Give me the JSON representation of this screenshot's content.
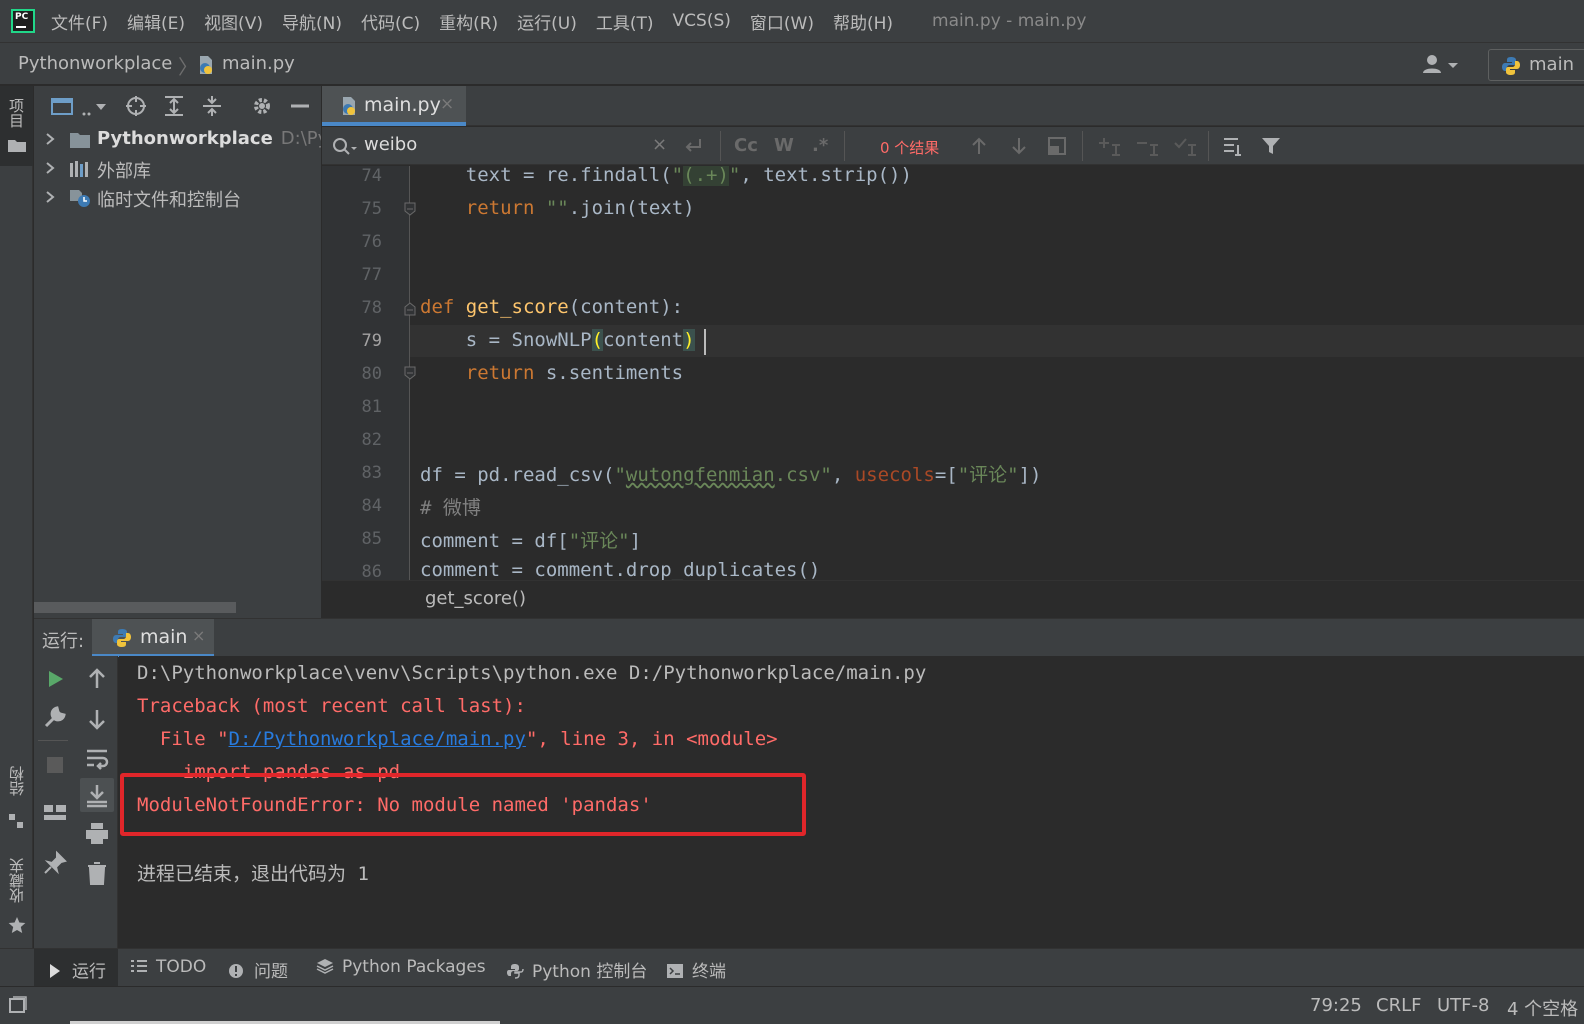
{
  "menubar": {
    "logo_text": "PC",
    "items": [
      "文件(F)",
      "编辑(E)",
      "视图(V)",
      "导航(N)",
      "代码(C)",
      "重构(R)",
      "运行(U)",
      "工具(T)",
      "VCS(S)",
      "窗口(W)",
      "帮助(H)"
    ],
    "window_title": "main.py - main.py"
  },
  "navbar": {
    "project": "Pythonworkplace",
    "separator": "〉",
    "file": "main.py",
    "run_config": "main"
  },
  "left_strip": {
    "project_label": "项目",
    "structure_label": "结构",
    "favorites_label": "收藏夹"
  },
  "project_tree": [
    {
      "label": "Pythonworkplace",
      "path": "D:\\Pyth",
      "icon": "folder-icon"
    },
    {
      "label": "外部库",
      "path": "",
      "icon": "library-icon"
    },
    {
      "label": "临时文件和控制台",
      "path": "",
      "icon": "scratch-icon"
    }
  ],
  "editor": {
    "tab_label": "main.py",
    "tab_close": "×",
    "find": {
      "query": "weibo",
      "clear": "×",
      "match_case": "Cc",
      "words": "W",
      "regex": ".*",
      "result": "0 个结果"
    },
    "line_numbers": [
      "74",
      "75",
      "76",
      "77",
      "78",
      "79",
      "80",
      "81",
      "82",
      "83",
      "84",
      "85",
      "86"
    ],
    "current_line": "79",
    "breadcrumb": "get_score()"
  },
  "run_panel": {
    "title": "运行:",
    "tab_label": "main",
    "tab_close": "×",
    "console": {
      "cmd": "D:\\Pythonworkplace\\venv\\Scripts\\python.exe D:/Pythonworkplace/main.py",
      "traceback": "Traceback (most recent call last):",
      "file_prefix": "  File \"",
      "file_link": "D:/Pythonworkplace/main.py",
      "file_suffix": "\", line 3, in <module>",
      "import_line": "    import pandas as pd",
      "error": "ModuleNotFoundError: No module named 'pandas'",
      "exit": "进程已结束，退出代码为 1"
    }
  },
  "toolwindows": {
    "run": "运行",
    "todo": "TODO",
    "problems": "问题",
    "packages": "Python Packages",
    "console": "Python 控制台",
    "terminal": "终端"
  },
  "status": {
    "position": "79:25",
    "line_sep": "CRLF",
    "encoding": "UTF-8",
    "indent": "4 个空格"
  },
  "colors": {
    "accent": "#4a88c7",
    "error_text": "#ff6b68",
    "highlight_box": "#e0262a",
    "keyword": "#cc7832",
    "function": "#ffc66d",
    "string": "#6a8759"
  }
}
